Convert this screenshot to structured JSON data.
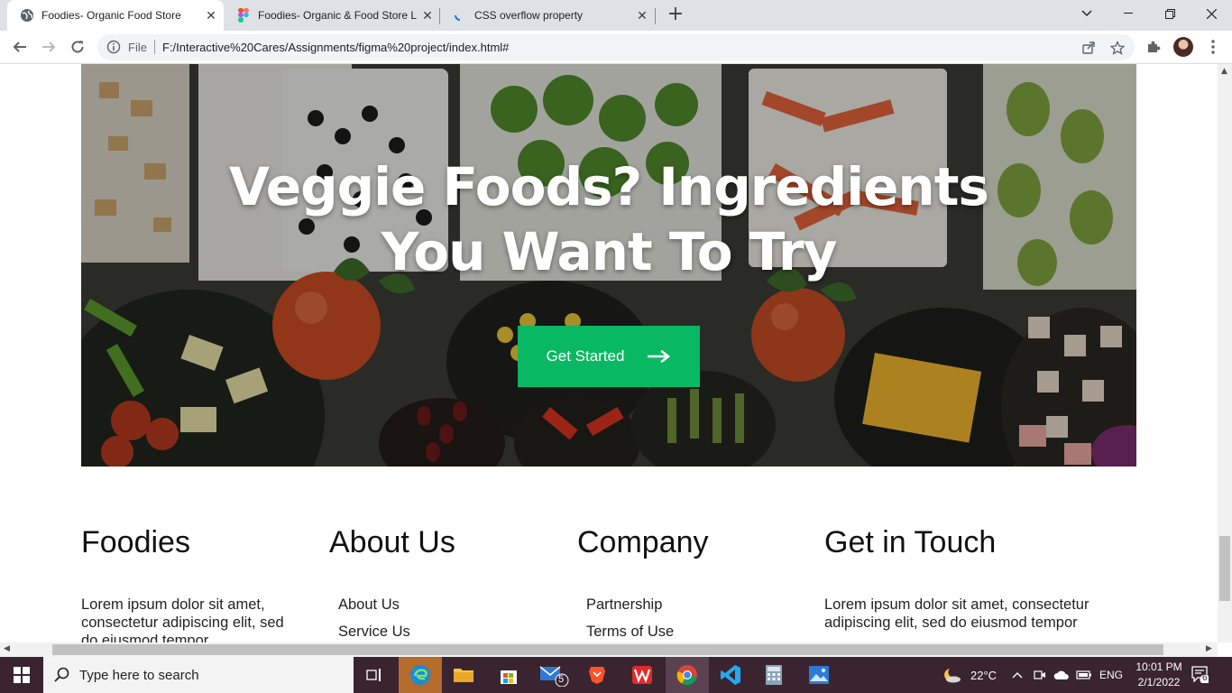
{
  "browser": {
    "tabs": [
      {
        "title": "Foodies- Organic Food Store",
        "active": true,
        "favicon": "globe-icon"
      },
      {
        "title": "Foodies- Organic & Food Store L",
        "active": false,
        "favicon": "figma-icon"
      },
      {
        "title": "CSS overflow property",
        "active": false,
        "favicon": "loading-icon"
      }
    ],
    "address": {
      "scheme_label": "File",
      "url": "F:/Interactive%20Cares/Assignments/figma%20project/index.html#"
    }
  },
  "page": {
    "hero": {
      "title_line1": "Veggie Foods? Ingredients",
      "title_line2": "You Want To Try",
      "cta_label": "Get Started"
    },
    "footer": {
      "col1": {
        "heading": "Foodies",
        "text": "Lorem ipsum dolor sit amet, consectetur adipiscing elit, sed do eiusmod tempor"
      },
      "col2": {
        "heading": "About Us",
        "links": [
          "About Us",
          "Service Us"
        ]
      },
      "col3": {
        "heading": "Company",
        "links": [
          "Partnership",
          "Terms of Use"
        ]
      },
      "col4": {
        "heading": "Get in Touch",
        "text": "Lorem ipsum dolor sit amet, consectetur adipiscing elit, sed do eiusmod tempor"
      }
    },
    "colors": {
      "accent": "#09b863"
    }
  },
  "taskbar": {
    "search_placeholder": "Type here to search",
    "mail_badge": "5",
    "weather": "22°C",
    "language": "ENG",
    "time": "10:01 PM",
    "date": "2/1/2022",
    "notification_count": "6"
  }
}
